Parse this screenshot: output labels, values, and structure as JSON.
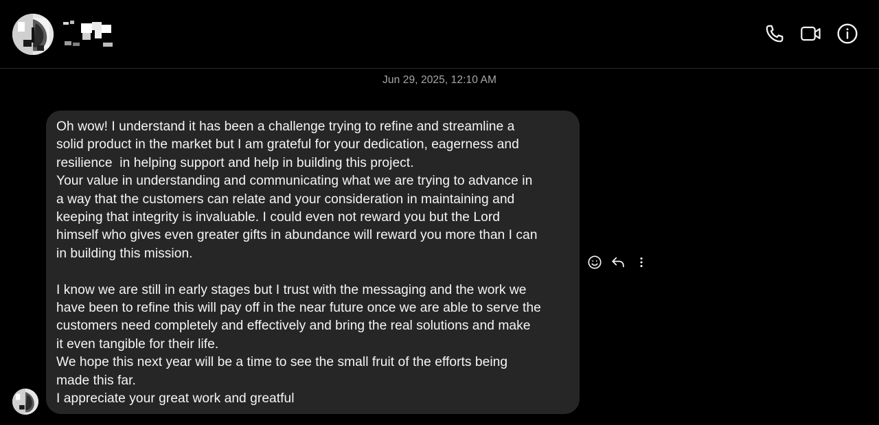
{
  "header": {
    "avatar_icon": "avatar-icon",
    "actions": [
      {
        "name": "phone-call-button",
        "icon": "phone-icon"
      },
      {
        "name": "video-call-button",
        "icon": "video-camera-icon"
      },
      {
        "name": "conversation-info-button",
        "icon": "info-icon"
      }
    ]
  },
  "thread": {
    "timestamp": "Jun 29, 2025, 12:10 AM",
    "messages": [
      {
        "text": "Oh wow! I understand it has been a challenge trying to refine and streamline a\nsolid product in the market but I am grateful for your dedication, eagerness and\nresilience  in helping support and help in building this project.\nYour value in understanding and communicating what we are trying to advance in\na way that the customers can relate and your consideration in maintaining and\nkeeping that integrity is invaluable. I could even not reward you but the Lord\nhimself who gives even greater gifts in abundance will reward you more than I can\nin building this mission.\n\nI know we are still in early stages but I trust with the messaging and the work we\nhave been to refine this will pay off in the near future once we are able to serve the\ncustomers need completely and effectively and bring the real solutions and make\nit even tangible for their life.\nWe hope this next year will be a time to see the small fruit of the efforts being\nmade this far.\nI appreciate your great work and greatful"
      }
    ],
    "message_actions": [
      {
        "name": "react-button",
        "icon": "smiley-icon"
      },
      {
        "name": "reply-button",
        "icon": "reply-arrow-icon"
      },
      {
        "name": "more-options-button",
        "icon": "vertical-ellipsis-icon"
      }
    ]
  },
  "colors": {
    "background": "#000000",
    "bubble": "#262626",
    "text": "#f5f5f5",
    "muted_text": "#a8a8a8",
    "divider": "#2a2a2a"
  }
}
